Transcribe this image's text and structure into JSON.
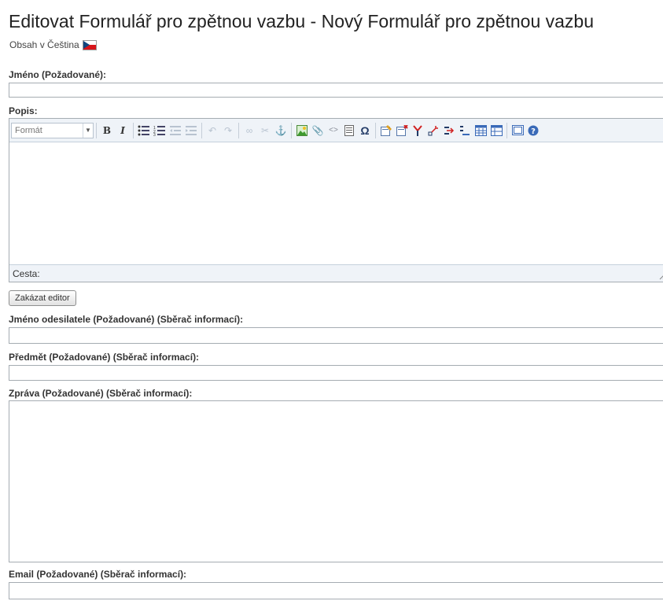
{
  "page": {
    "title": "Editovat Formulář pro zpětnou vazbu - Nový Formulář pro zpětnou vazbu",
    "content_language": "Obsah v Čeština"
  },
  "fields": {
    "name": {
      "label": "Jméno (Požadované):",
      "value": ""
    },
    "description": {
      "label": "Popis:",
      "value": ""
    },
    "sender_name": {
      "label": "Jméno odesilatele (Požadované) (Sběrač informací):",
      "value": ""
    },
    "subject": {
      "label": "Předmět (Požadované) (Sběrač informací):",
      "value": ""
    },
    "message": {
      "label": "Zpráva (Požadované) (Sběrač informací):",
      "value": ""
    },
    "email": {
      "label": "Email (Požadované) (Sběrač informací):",
      "value": ""
    }
  },
  "editor": {
    "format_select": "Formát",
    "bold": "B",
    "italic": "I",
    "path_label": "Cesta:",
    "disable_button": "Zakázat editor",
    "tools": [
      "bullet-list-icon",
      "numbered-list-icon",
      "outdent-icon",
      "indent-icon",
      "undo-icon",
      "redo-icon",
      "link-icon",
      "unlink-icon",
      "anchor-icon",
      "image-icon",
      "attachment-icon",
      "code-icon",
      "template-icon",
      "special-char-icon",
      "insert-form-icon",
      "insert-layer-icon",
      "split-cell-icon",
      "merge-cell-icon",
      "insert-row-icon",
      "delete-row-icon",
      "insert-table-icon",
      "table-props-icon",
      "fullscreen-icon",
      "help-icon"
    ]
  },
  "colors": {
    "toolbar_bg": "#eff3f8",
    "border": "#a5acb2",
    "flag_red": "#d7141a",
    "flag_blue": "#11457e"
  }
}
